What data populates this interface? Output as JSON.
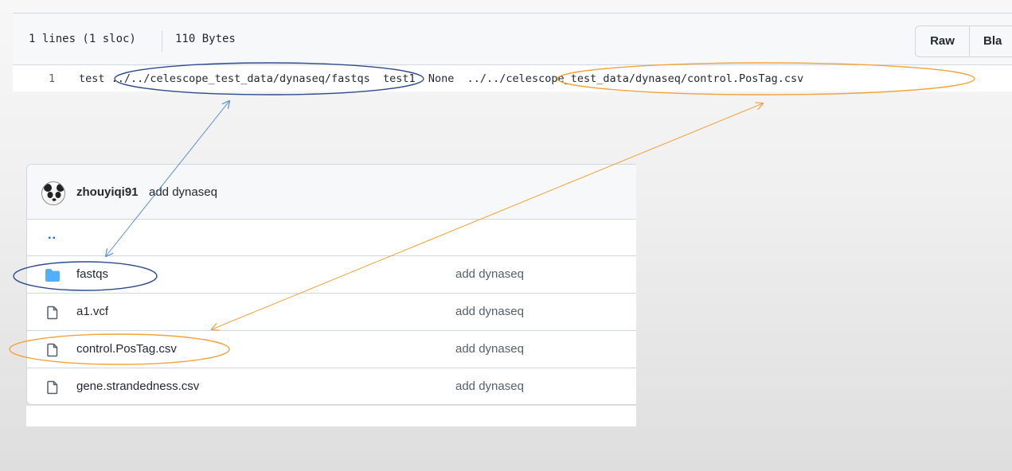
{
  "file_header": {
    "lines": "1 lines (1 sloc)",
    "size": "110 Bytes",
    "raw_button": "Raw",
    "blame_button": "Bla"
  },
  "code": {
    "line_number": "1",
    "text": "test ../../celescope_test_data/dynaseq/fastqs  test1  None  ../../celescope_test_data/dynaseq/control.PosTag.csv"
  },
  "commit": {
    "author": "zhouyiqi91",
    "message": "add dynaseq"
  },
  "listing": {
    "parent": "..",
    "items": [
      {
        "name": "fastqs",
        "type": "folder",
        "message": "add dynaseq"
      },
      {
        "name": "a1.vcf",
        "type": "file",
        "message": "add dynaseq"
      },
      {
        "name": "control.PosTag.csv",
        "type": "file",
        "message": "add dynaseq"
      },
      {
        "name": "gene.strandedness.csv",
        "type": "file",
        "message": "add dynaseq"
      }
    ]
  },
  "colors": {
    "highlight_blue": "#2e4a8e",
    "highlight_orange": "#f2a33a",
    "arrow_blue": "#5b8fd6",
    "folder_icon": "#54aeff"
  }
}
